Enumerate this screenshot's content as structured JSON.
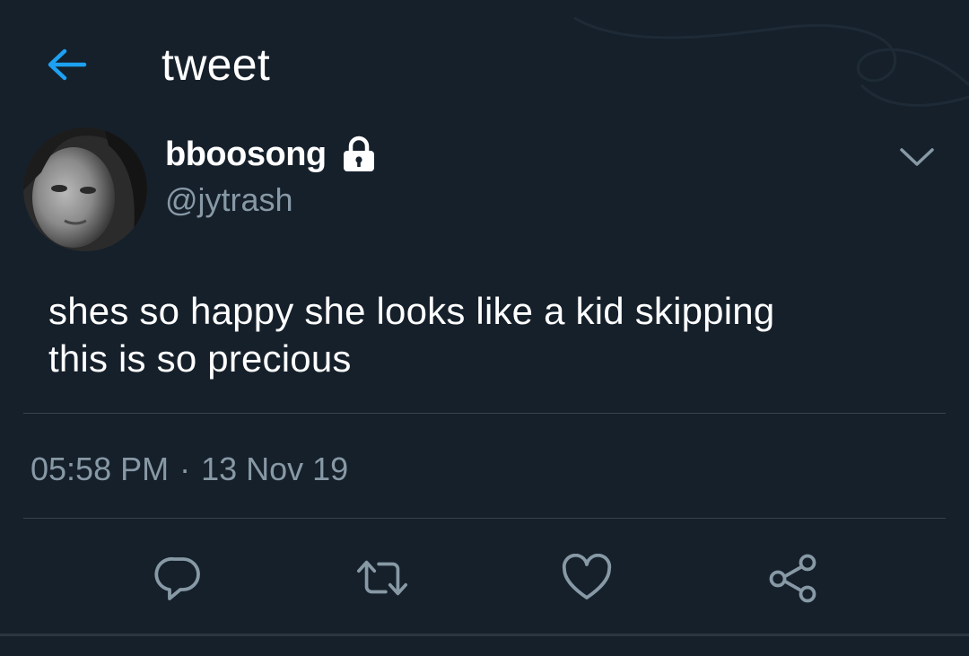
{
  "header": {
    "title": "tweet",
    "back_icon": "arrow-left-icon"
  },
  "tweet": {
    "author": {
      "display_name": "bboosong",
      "handle": "@jytrash",
      "protected_icon": "lock-icon"
    },
    "text_lines": [
      "shes so happy she looks like a kid skipping",
      "this is so precious"
    ],
    "time": "05:58 PM",
    "separator": "·",
    "date": "13 Nov 19"
  },
  "actions": {
    "reply_icon": "reply-icon",
    "retweet_icon": "retweet-icon",
    "like_icon": "heart-icon",
    "share_icon": "share-icon"
  },
  "colors": {
    "background": "#15202b",
    "accent": "#1da1f2",
    "secondary_text": "#8899a6",
    "divider": "#38444d"
  }
}
